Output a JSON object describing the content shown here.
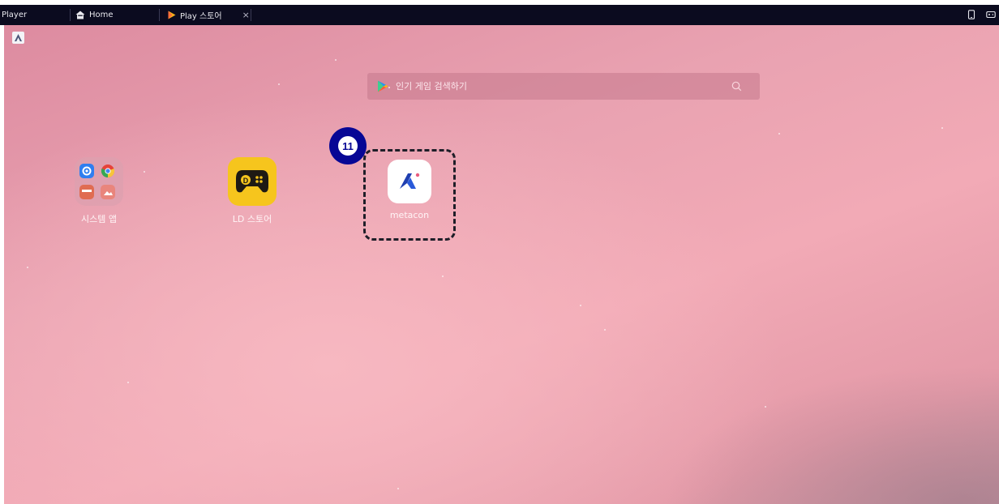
{
  "titlebar": {
    "app_name": "Player",
    "tabs": [
      {
        "label": "Home",
        "icon": "home-icon"
      },
      {
        "label": "Play 스토어",
        "icon": "play-store-icon"
      }
    ],
    "close_symbol": "×",
    "right_icons": [
      "phone-icon",
      "gamepad-icon"
    ]
  },
  "desktop": {
    "top_badge": "A",
    "search": {
      "placeholder": "인기 게임 검색하기",
      "icon": "search-icon"
    },
    "apps": [
      {
        "label": "시스템 앱",
        "icon": "system-apps-folder-icon"
      },
      {
        "label": "LD 스토어",
        "icon": "ld-store-icon"
      },
      {
        "label": "metacon",
        "icon": "metacon-icon"
      }
    ],
    "annotation": {
      "step": "11",
      "target": "metacon"
    }
  },
  "colors": {
    "titlebar_bg": "#0b0b1f",
    "ld_store_yellow": "#f6c51d",
    "step_badge_blue": "#070795",
    "metacon_blue": "#1f3fb0"
  }
}
